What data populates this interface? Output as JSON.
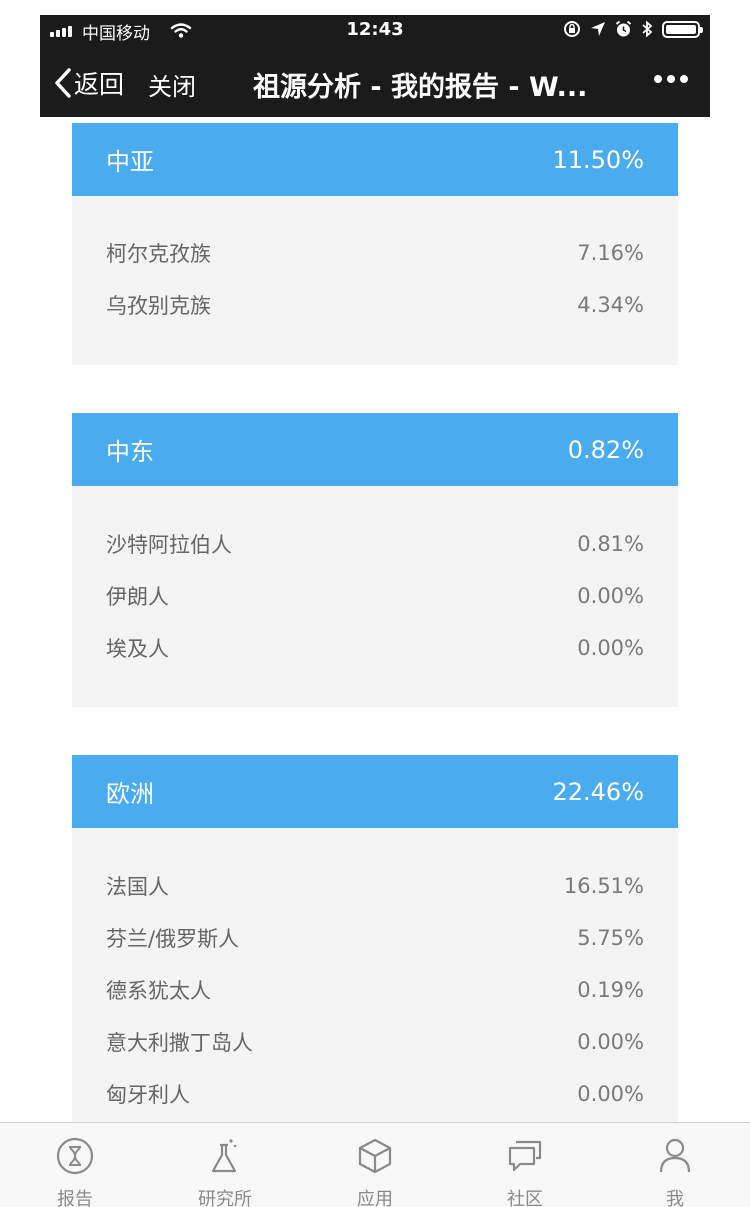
{
  "status_bar": {
    "carrier": "中国移动",
    "time": "12:43"
  },
  "nav": {
    "back_label": "返回",
    "close_label": "关闭",
    "title": "祖源分析 - 我的报告 - W..."
  },
  "regions": [
    {
      "name": "中亚",
      "percent": "11.50%",
      "populations": [
        {
          "name": "柯尔克孜族",
          "percent": "7.16%"
        },
        {
          "name": "乌孜别克族",
          "percent": "4.34%"
        }
      ]
    },
    {
      "name": "中东",
      "percent": "0.82%",
      "populations": [
        {
          "name": "沙特阿拉伯人",
          "percent": "0.81%"
        },
        {
          "name": "伊朗人",
          "percent": "0.00%"
        },
        {
          "name": "埃及人",
          "percent": "0.00%"
        }
      ]
    },
    {
      "name": "欧洲",
      "percent": "22.46%",
      "populations": [
        {
          "name": "法国人",
          "percent": "16.51%"
        },
        {
          "name": "芬兰/俄罗斯人",
          "percent": "5.75%"
        },
        {
          "name": "德系犹太人",
          "percent": "0.19%"
        },
        {
          "name": "意大利撒丁岛人",
          "percent": "0.00%"
        },
        {
          "name": "匈牙利人",
          "percent": "0.00%"
        }
      ]
    }
  ],
  "tabs": [
    {
      "label": "报告",
      "icon": "dna-report-icon"
    },
    {
      "label": "研究所",
      "icon": "flask-icon"
    },
    {
      "label": "应用",
      "icon": "cube-icon"
    },
    {
      "label": "社区",
      "icon": "chat-bubbles-icon"
    },
    {
      "label": "我",
      "icon": "user-icon"
    }
  ],
  "colors": {
    "header_bar": "#1b1b1b",
    "card_header": "#4aacef",
    "card_body": "#f4f4f4"
  }
}
